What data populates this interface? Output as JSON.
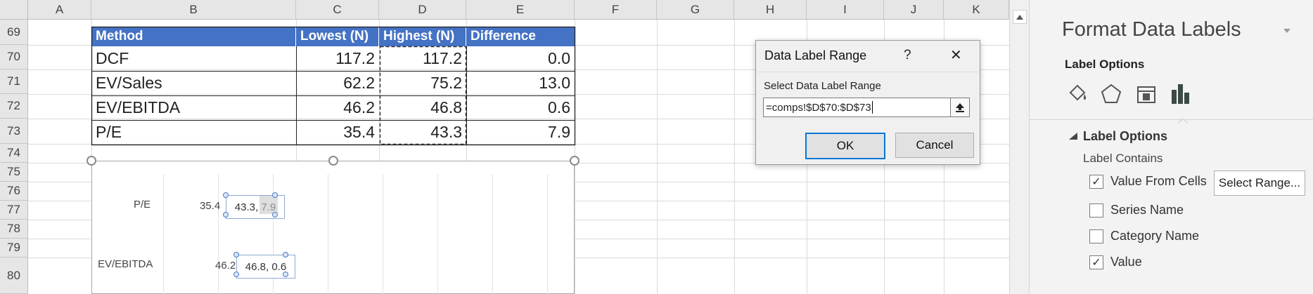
{
  "spreadsheet": {
    "columns": [
      "A",
      "B",
      "C",
      "D",
      "E",
      "F",
      "G",
      "H",
      "I",
      "J",
      "K"
    ],
    "rows": [
      "69",
      "70",
      "71",
      "72",
      "73",
      "74",
      "75",
      "76",
      "77",
      "78",
      "79",
      "80"
    ],
    "table": {
      "headers": [
        "Method",
        "Lowest (N)",
        "Highest (N)",
        "Difference"
      ],
      "rows": [
        [
          "DCF",
          "117.2",
          "117.2",
          "0.0"
        ],
        [
          "EV/Sales",
          "62.2",
          "75.2",
          "13.0"
        ],
        [
          "EV/EBITDA",
          "46.2",
          "46.8",
          "0.6"
        ],
        [
          "P/E",
          "35.4",
          "43.3",
          "7.9"
        ]
      ]
    }
  },
  "chart": {
    "categories": [
      "P/E",
      "EV/EBITDA"
    ],
    "low_labels": [
      "35.4",
      "46.2"
    ],
    "point_labels": [
      "43.3, 7.9",
      "46.8, 0.6"
    ]
  },
  "dialog": {
    "title": "Data Label Range",
    "help": "?",
    "close": "✕",
    "prompt": "Select Data Label Range",
    "range_value": "=comps!$D$70:$D$73",
    "ok": "OK",
    "cancel": "Cancel"
  },
  "pane": {
    "title": "Format Data Labels",
    "tab": "Label Options",
    "section": "Label Options",
    "group": "Label Contains",
    "options": [
      {
        "label": "Value From Cells",
        "checked": true
      },
      {
        "label": "Series Name",
        "checked": false
      },
      {
        "label": "Category Name",
        "checked": false
      },
      {
        "label": "Value",
        "checked": true
      }
    ],
    "select_range": "Select Range..."
  }
}
